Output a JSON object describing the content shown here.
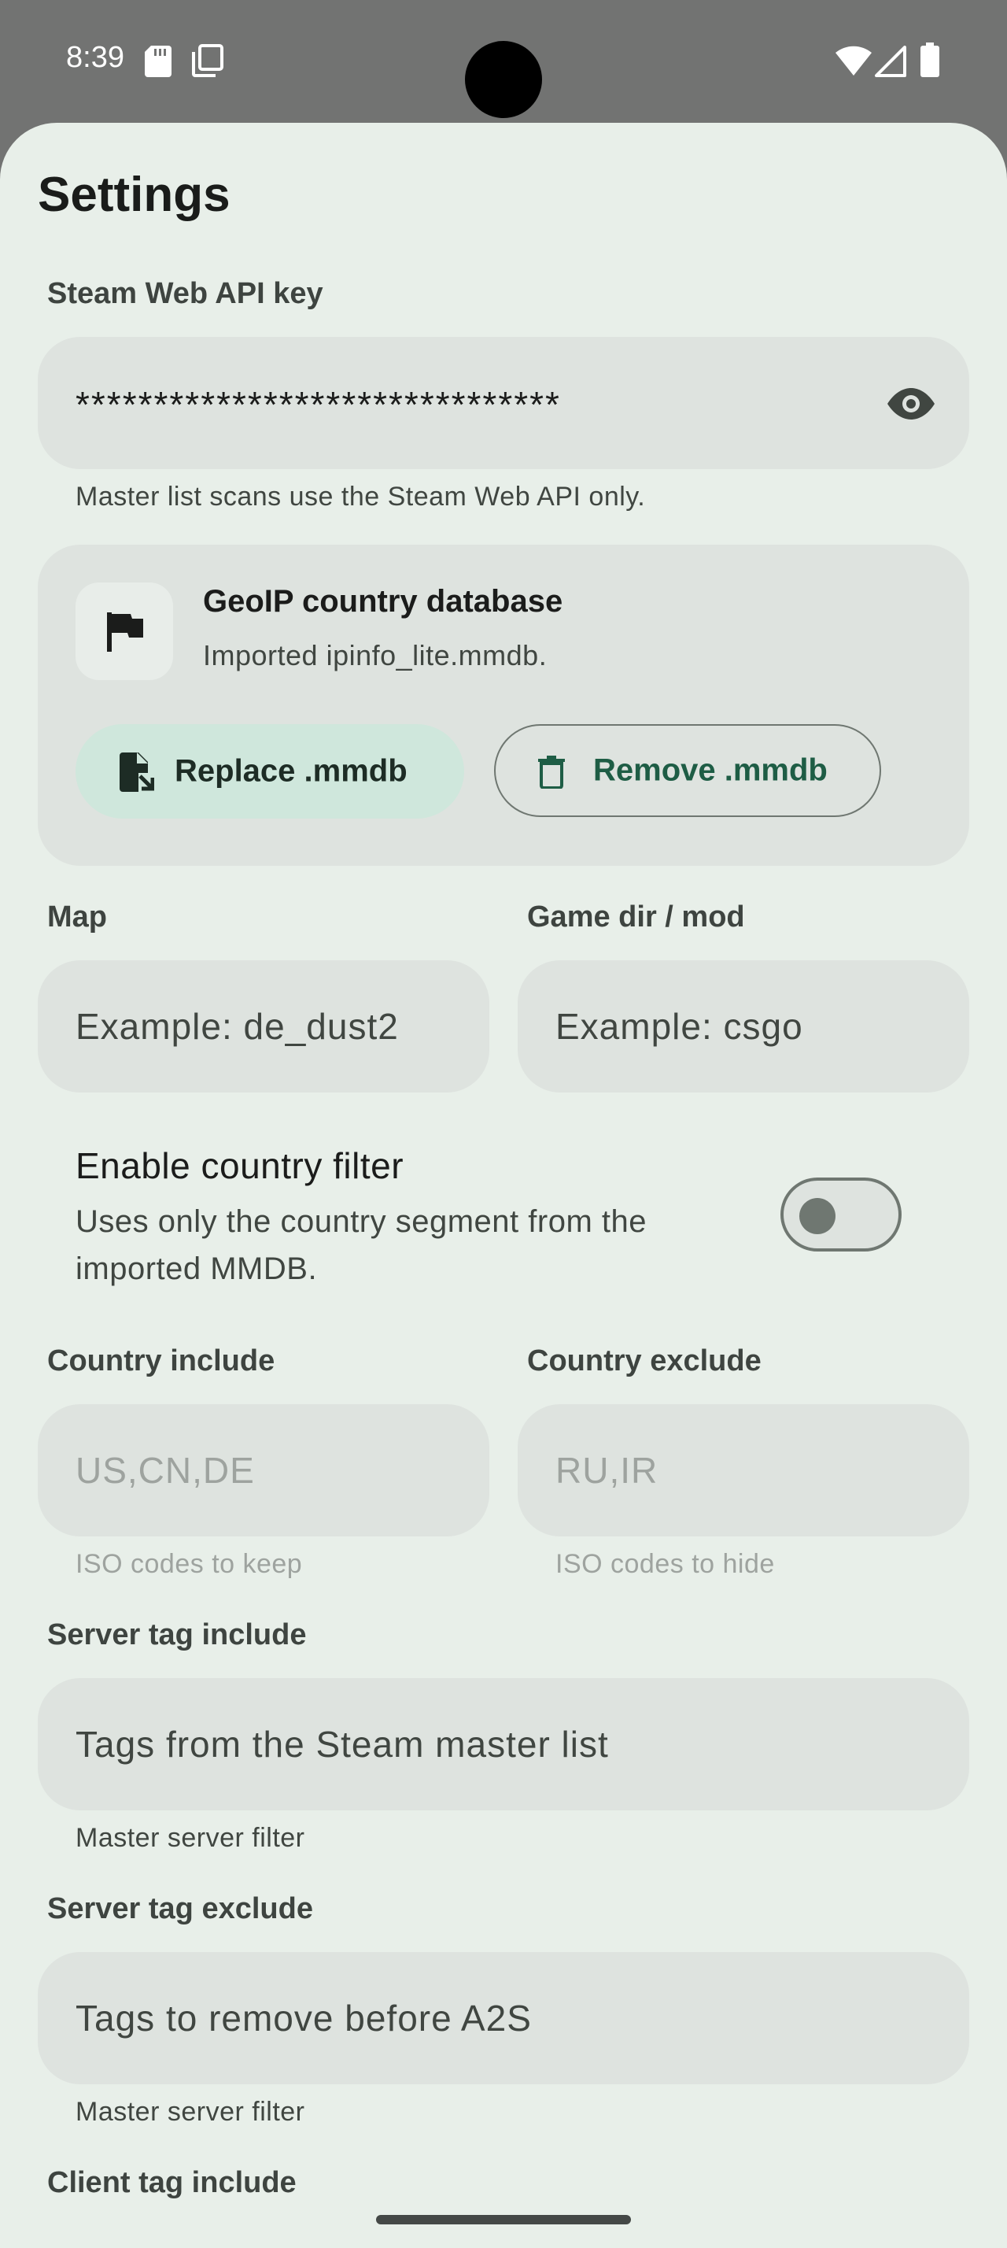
{
  "status_bar": {
    "time": "8:39",
    "icons": [
      "sd-card-icon",
      "screenshot-icon",
      "wifi-icon",
      "signal-icon",
      "battery-icon"
    ]
  },
  "page": {
    "title": "Settings"
  },
  "api_key": {
    "label": "Steam Web API key",
    "value": "*******************************",
    "visibility_icon": "eye-icon",
    "helper": "Master list scans use the Steam Web API only."
  },
  "geoip": {
    "icon": "flag-icon",
    "title": "GeoIP country database",
    "subtitle": "Imported ipinfo_lite.mmdb.",
    "replace_label": "Replace .mmdb",
    "replace_icon": "file-replace-icon",
    "remove_label": "Remove .mmdb",
    "remove_icon": "trash-icon"
  },
  "map": {
    "label": "Map",
    "placeholder": "Example: de_dust2"
  },
  "game_dir": {
    "label": "Game dir / mod",
    "placeholder": "Example: csgo"
  },
  "country_filter": {
    "title": "Enable country filter",
    "description": "Uses only the country segment from the imported MMDB.",
    "enabled": false
  },
  "country_include": {
    "label": "Country include",
    "placeholder": "US,CN,DE",
    "helper": "ISO codes to keep"
  },
  "country_exclude": {
    "label": "Country exclude",
    "placeholder": "RU,IR",
    "helper": "ISO codes to hide"
  },
  "server_tag_include": {
    "label": "Server tag include",
    "placeholder": "Tags from the Steam master list",
    "helper": "Master server filter"
  },
  "server_tag_exclude": {
    "label": "Server tag exclude",
    "placeholder": "Tags to remove before A2S",
    "helper": "Master server filter"
  },
  "client_tag_include": {
    "label": "Client tag include"
  },
  "colors": {
    "background": "#e8efe9",
    "field": "#dee3df",
    "accent": "#1e5d45",
    "tonal_button": "#cfe7dc",
    "status_bar": "#727372"
  }
}
